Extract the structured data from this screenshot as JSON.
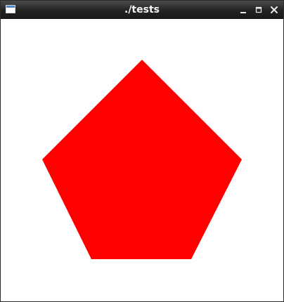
{
  "window": {
    "title": "./tests",
    "icons": {
      "app": "app-window-icon",
      "minimize": "minimize-icon",
      "maximize": "maximize-icon",
      "close": "close-icon"
    }
  },
  "content": {
    "shape": "pentagon",
    "fill_color": "#ff0000",
    "background_color": "#ffffff"
  },
  "colors": {
    "titlebar": "#242424",
    "title_text": "#f4f4f4"
  }
}
